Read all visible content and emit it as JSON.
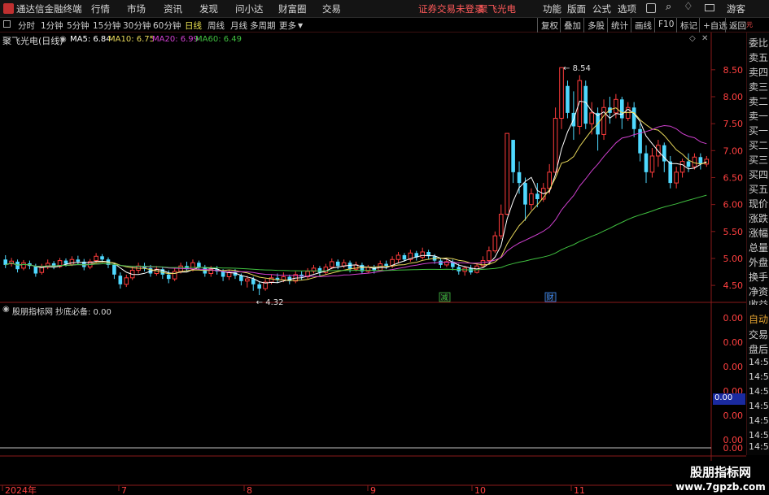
{
  "menu": {
    "app_title": "通达信金融终端",
    "items": [
      "行情",
      "市场",
      "资讯",
      "发现",
      "问小达",
      "财富圈",
      "交易"
    ],
    "notice": "证券交易未登录",
    "stock_name": "聚飞光电",
    "right_items": [
      "功能",
      "版面",
      "公式",
      "选项"
    ],
    "guest": "游客"
  },
  "periods": {
    "items": [
      "分时",
      "1分钟",
      "5分钟",
      "15分钟",
      "30分钟",
      "60分钟",
      "日线",
      "周线",
      "月线",
      "多周期",
      "更多"
    ],
    "active": "日线",
    "tools": [
      "复权",
      "叠加",
      "多股",
      "统计",
      "画线",
      "F10",
      "标记",
      "+自选",
      "返回"
    ]
  },
  "main_chart": {
    "title": "聚飞光电(日线)",
    "ma": [
      {
        "label": "MA5: 6.84",
        "color": "#ffffff"
      },
      {
        "label": "MA10: 6.75",
        "color": "#e8d85a"
      },
      {
        "label": "MA20: 6.99",
        "color": "#d040d0"
      },
      {
        "label": "MA60: 6.49",
        "color": "#40c040"
      }
    ],
    "high_label": "8.54",
    "low_label": "4.32",
    "markers": [
      "减",
      "财"
    ]
  },
  "sub_chart": {
    "title": "股朋指标网",
    "indicator": "抄底必备: 0.00",
    "current_value": "0.00"
  },
  "side_panel": {
    "top_items": [
      "委比",
      "卖五",
      "卖四",
      "卖三",
      "卖二",
      "卖一",
      "买一",
      "买二",
      "买三",
      "买四",
      "买五",
      "现价",
      "涨跌",
      "涨幅",
      "总量",
      "外盘",
      "换手",
      "净资",
      "收益"
    ],
    "bottom_items": [
      "自动",
      "交易",
      "盘后",
      "14:56",
      "14:56",
      "14:56",
      "14:56",
      "14:56",
      "14:56",
      "14:56",
      "14:56"
    ]
  },
  "watermark": {
    "title": "股朋指标网",
    "url": "www.7gpzb.com"
  },
  "chart_data": {
    "type": "candlestick",
    "title": "聚飞光电(日线)",
    "price_axis": {
      "ticks": [
        8.5,
        8.0,
        7.5,
        7.0,
        6.5,
        6.0,
        5.5,
        5.0,
        4.5
      ],
      "range": [
        4.2,
        8.95
      ]
    },
    "sub_axis": {
      "ticks": [
        0.0,
        0.0,
        0.0,
        0.0,
        0.0,
        0.0,
        0.0
      ],
      "tick_labels": [
        "0.00",
        "0.00",
        "0.00",
        "0.00",
        "0.00",
        "0.00",
        "0.00"
      ]
    },
    "time_axis": {
      "labels": [
        "2024年",
        "7",
        "8",
        "9",
        "10",
        "11"
      ]
    },
    "candles": [
      [
        4.98,
        4.88,
        5.06,
        4.82
      ],
      [
        4.9,
        4.95,
        5.01,
        4.85
      ],
      [
        4.94,
        4.8,
        4.98,
        4.74
      ],
      [
        4.82,
        4.92,
        4.97,
        4.78
      ],
      [
        4.91,
        4.86,
        4.96,
        4.8
      ],
      [
        4.86,
        4.72,
        4.9,
        4.66
      ],
      [
        4.74,
        4.84,
        4.9,
        4.7
      ],
      [
        4.84,
        4.91,
        4.98,
        4.8
      ],
      [
        4.91,
        4.85,
        4.95,
        4.8
      ],
      [
        4.85,
        4.96,
        5.01,
        4.82
      ],
      [
        4.96,
        4.9,
        5.0,
        4.85
      ],
      [
        4.89,
        4.98,
        5.04,
        4.86
      ],
      [
        4.98,
        4.94,
        5.05,
        4.88
      ],
      [
        4.94,
        4.84,
        4.99,
        4.78
      ],
      [
        4.84,
        4.94,
        4.99,
        4.8
      ],
      [
        4.96,
        5.04,
        5.1,
        4.91
      ],
      [
        5.04,
        4.98,
        5.08,
        4.92
      ],
      [
        4.98,
        4.88,
        5.02,
        4.82
      ],
      [
        4.88,
        4.7,
        4.92,
        4.62
      ],
      [
        4.68,
        4.52,
        4.74,
        4.44
      ],
      [
        4.52,
        4.64,
        4.7,
        4.47
      ],
      [
        4.64,
        4.78,
        4.84,
        4.6
      ],
      [
        4.78,
        4.86,
        4.92,
        4.72
      ],
      [
        4.86,
        4.82,
        4.92,
        4.76
      ],
      [
        4.82,
        4.72,
        4.88,
        4.66
      ],
      [
        4.72,
        4.8,
        4.86,
        4.68
      ],
      [
        4.8,
        4.7,
        4.85,
        4.62
      ],
      [
        4.7,
        4.62,
        4.78,
        4.54
      ],
      [
        4.62,
        4.76,
        4.82,
        4.58
      ],
      [
        4.76,
        4.86,
        4.92,
        4.72
      ],
      [
        4.86,
        4.8,
        4.94,
        4.76
      ],
      [
        4.8,
        4.92,
        4.98,
        4.76
      ],
      [
        4.92,
        4.84,
        4.96,
        4.78
      ],
      [
        4.84,
        4.72,
        4.88,
        4.66
      ],
      [
        4.72,
        4.8,
        4.86,
        4.66
      ],
      [
        4.8,
        4.76,
        4.86,
        4.7
      ],
      [
        4.76,
        4.66,
        4.8,
        4.58
      ],
      [
        4.66,
        4.74,
        4.78,
        4.6
      ],
      [
        4.74,
        4.68,
        4.8,
        4.62
      ],
      [
        4.68,
        4.58,
        4.72,
        4.5
      ],
      [
        4.58,
        4.62,
        4.68,
        4.46
      ],
      [
        4.62,
        4.52,
        4.66,
        4.4
      ],
      [
        4.52,
        4.44,
        4.56,
        4.32
      ],
      [
        4.44,
        4.56,
        4.62,
        4.4
      ],
      [
        4.56,
        4.64,
        4.7,
        4.52
      ],
      [
        4.64,
        4.6,
        4.72,
        4.54
      ],
      [
        4.6,
        4.66,
        4.74,
        4.56
      ],
      [
        4.66,
        4.58,
        4.7,
        4.52
      ],
      [
        4.58,
        4.7,
        4.76,
        4.54
      ],
      [
        4.7,
        4.66,
        4.76,
        4.6
      ],
      [
        4.66,
        4.76,
        4.82,
        4.62
      ],
      [
        4.76,
        4.82,
        4.88,
        4.72
      ],
      [
        4.82,
        4.74,
        4.86,
        4.68
      ],
      [
        4.74,
        4.84,
        4.9,
        4.7
      ],
      [
        4.84,
        4.94,
        5.0,
        4.8
      ],
      [
        4.94,
        4.86,
        4.98,
        4.8
      ],
      [
        4.86,
        4.92,
        4.98,
        4.82
      ],
      [
        4.92,
        4.8,
        4.96,
        4.74
      ],
      [
        4.8,
        4.88,
        4.94,
        4.76
      ],
      [
        4.88,
        4.76,
        4.92,
        4.72
      ],
      [
        4.76,
        4.84,
        4.88,
        4.72
      ],
      [
        4.84,
        4.78,
        4.88,
        4.72
      ],
      [
        4.78,
        4.9,
        4.96,
        4.76
      ],
      [
        4.9,
        4.86,
        4.96,
        4.8
      ],
      [
        4.86,
        4.98,
        5.04,
        4.82
      ],
      [
        4.98,
        5.06,
        5.12,
        4.92
      ],
      [
        5.06,
        4.98,
        5.1,
        4.94
      ],
      [
        4.98,
        5.1,
        5.16,
        4.94
      ],
      [
        5.1,
        5.02,
        5.14,
        4.96
      ],
      [
        5.02,
        5.12,
        5.2,
        4.98
      ],
      [
        5.12,
        5.04,
        5.16,
        4.98
      ],
      [
        5.04,
        4.96,
        5.08,
        4.9
      ],
      [
        4.96,
        4.88,
        5.0,
        4.82
      ],
      [
        4.88,
        4.94,
        5.0,
        4.84
      ],
      [
        4.94,
        4.84,
        4.98,
        4.78
      ],
      [
        4.84,
        4.76,
        4.9,
        4.7
      ],
      [
        4.76,
        4.82,
        4.86,
        4.68
      ],
      [
        4.82,
        4.74,
        4.88,
        4.7
      ],
      [
        4.74,
        4.86,
        4.92,
        4.72
      ],
      [
        4.86,
        4.96,
        5.04,
        4.84
      ],
      [
        4.96,
        5.14,
        5.22,
        4.92
      ],
      [
        5.14,
        5.42,
        5.5,
        5.1
      ],
      [
        5.42,
        5.82,
        6.0,
        5.36
      ],
      [
        5.82,
        7.32,
        7.32,
        5.8
      ],
      [
        7.2,
        6.6,
        7.2,
        6.4
      ],
      [
        6.6,
        6.4,
        6.8,
        6.2
      ],
      [
        6.4,
        6.0,
        6.5,
        5.7
      ],
      [
        6.0,
        6.2,
        6.3,
        5.9
      ],
      [
        6.2,
        6.1,
        6.4,
        5.95
      ],
      [
        6.1,
        6.3,
        6.4,
        6.05
      ],
      [
        6.3,
        6.6,
        6.75,
        6.2
      ],
      [
        6.6,
        7.6,
        7.8,
        6.55
      ],
      [
        7.6,
        8.54,
        8.54,
        7.4
      ],
      [
        8.2,
        7.7,
        8.3,
        7.6
      ],
      [
        7.7,
        7.45,
        8.1,
        7.2
      ],
      [
        7.45,
        8.3,
        8.4,
        7.3
      ],
      [
        8.2,
        7.5,
        8.3,
        7.4
      ],
      [
        7.5,
        7.7,
        7.9,
        7.3
      ],
      [
        7.7,
        7.3,
        7.8,
        7.0
      ],
      [
        7.3,
        7.8,
        7.95,
        7.2
      ],
      [
        7.8,
        7.7,
        8.0,
        7.5
      ],
      [
        7.7,
        7.95,
        8.05,
        7.6
      ],
      [
        7.95,
        7.6,
        8.0,
        7.4
      ],
      [
        7.6,
        7.8,
        7.9,
        7.55
      ],
      [
        7.8,
        7.4,
        7.9,
        7.25
      ],
      [
        7.4,
        6.95,
        7.5,
        6.8
      ],
      [
        6.95,
        6.6,
        7.1,
        6.4
      ],
      [
        6.6,
        6.9,
        7.05,
        6.5
      ],
      [
        6.9,
        7.1,
        7.2,
        6.7
      ],
      [
        7.1,
        6.8,
        7.15,
        6.6
      ],
      [
        6.8,
        6.4,
        6.9,
        6.3
      ],
      [
        6.4,
        6.6,
        6.7,
        6.3
      ],
      [
        6.6,
        6.8,
        6.85,
        6.5
      ],
      [
        6.8,
        6.7,
        6.95,
        6.6
      ],
      [
        6.7,
        6.88,
        6.95,
        6.65
      ],
      [
        6.88,
        6.75,
        6.95,
        6.65
      ],
      [
        6.75,
        6.84,
        6.9,
        6.7
      ]
    ],
    "ma_series": [
      {
        "name": "MA5",
        "color": "#ffffff"
      },
      {
        "name": "MA10",
        "color": "#e8d85a"
      },
      {
        "name": "MA20",
        "color": "#d040d0"
      },
      {
        "name": "MA60",
        "color": "#40c040"
      }
    ]
  }
}
